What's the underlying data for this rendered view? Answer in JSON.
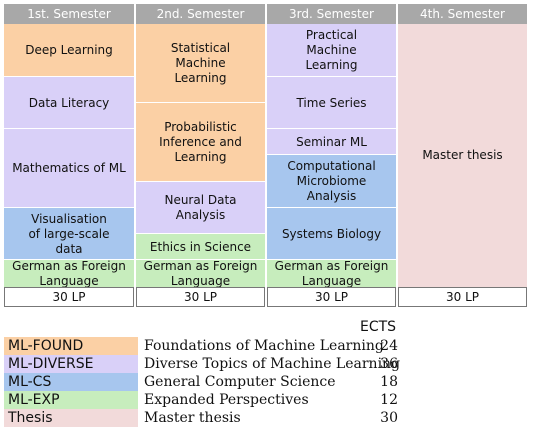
{
  "semesters": [
    "1st. Semester",
    "2nd. Semester",
    "3rd. Semester",
    "4th. Semester"
  ],
  "columns": [
    [
      {
        "label": "Deep Learning",
        "category": "ML-FOUND"
      },
      {
        "label": "Data Literacy",
        "category": "ML-DIVERSE"
      },
      {
        "label": "Mathematics of ML",
        "category": "ML-DIVERSE"
      },
      {
        "label": "Visualisation of large-scale data",
        "category": "ML-CS"
      },
      {
        "label": "German as Foreign Language",
        "category": "ML-EXP"
      }
    ],
    [
      {
        "label": "Statistical Machine Learning",
        "category": "ML-FOUND"
      },
      {
        "label": "Probabilistic Inference and Learning",
        "category": "ML-FOUND"
      },
      {
        "label": "Neural Data Analysis",
        "category": "ML-DIVERSE"
      },
      {
        "label": "Ethics in Science",
        "category": "ML-EXP"
      },
      {
        "label": "German as Foreign Language",
        "category": "ML-EXP"
      }
    ],
    [
      {
        "label": "Practical Machine Learning",
        "category": "ML-DIVERSE"
      },
      {
        "label": "Time Series",
        "category": "ML-DIVERSE"
      },
      {
        "label": "Seminar ML",
        "category": "ML-DIVERSE"
      },
      {
        "label": "Computational Microbiome Analysis",
        "category": "ML-CS"
      },
      {
        "label": "Systems Biology",
        "category": "ML-CS"
      },
      {
        "label": "German as Foreign Language",
        "category": "ML-EXP"
      }
    ],
    [
      {
        "label": "Master thesis",
        "category": "Thesis"
      }
    ]
  ],
  "credits": [
    "30 LP",
    "30 LP",
    "30 LP",
    "30 LP"
  ],
  "legend": {
    "ects_header": "ECTS",
    "items": [
      {
        "name": "ML-FOUND",
        "description": "Foundations of Machine Learning",
        "ects": "24",
        "color": "#fbd0a5"
      },
      {
        "name": "ML-DIVERSE",
        "description": "Diverse Topics of Machine Learning",
        "ects": "36",
        "color": "#d9d0f8"
      },
      {
        "name": "ML-CS",
        "description": "General Computer Science",
        "ects": "18",
        "color": "#a7c6ee"
      },
      {
        "name": "ML-EXP",
        "description": "Expanded Perspectives",
        "ects": "12",
        "color": "#c7edbd"
      },
      {
        "name": "Thesis",
        "description": "Master thesis",
        "ects": "30",
        "color": "#f2dada"
      }
    ]
  }
}
